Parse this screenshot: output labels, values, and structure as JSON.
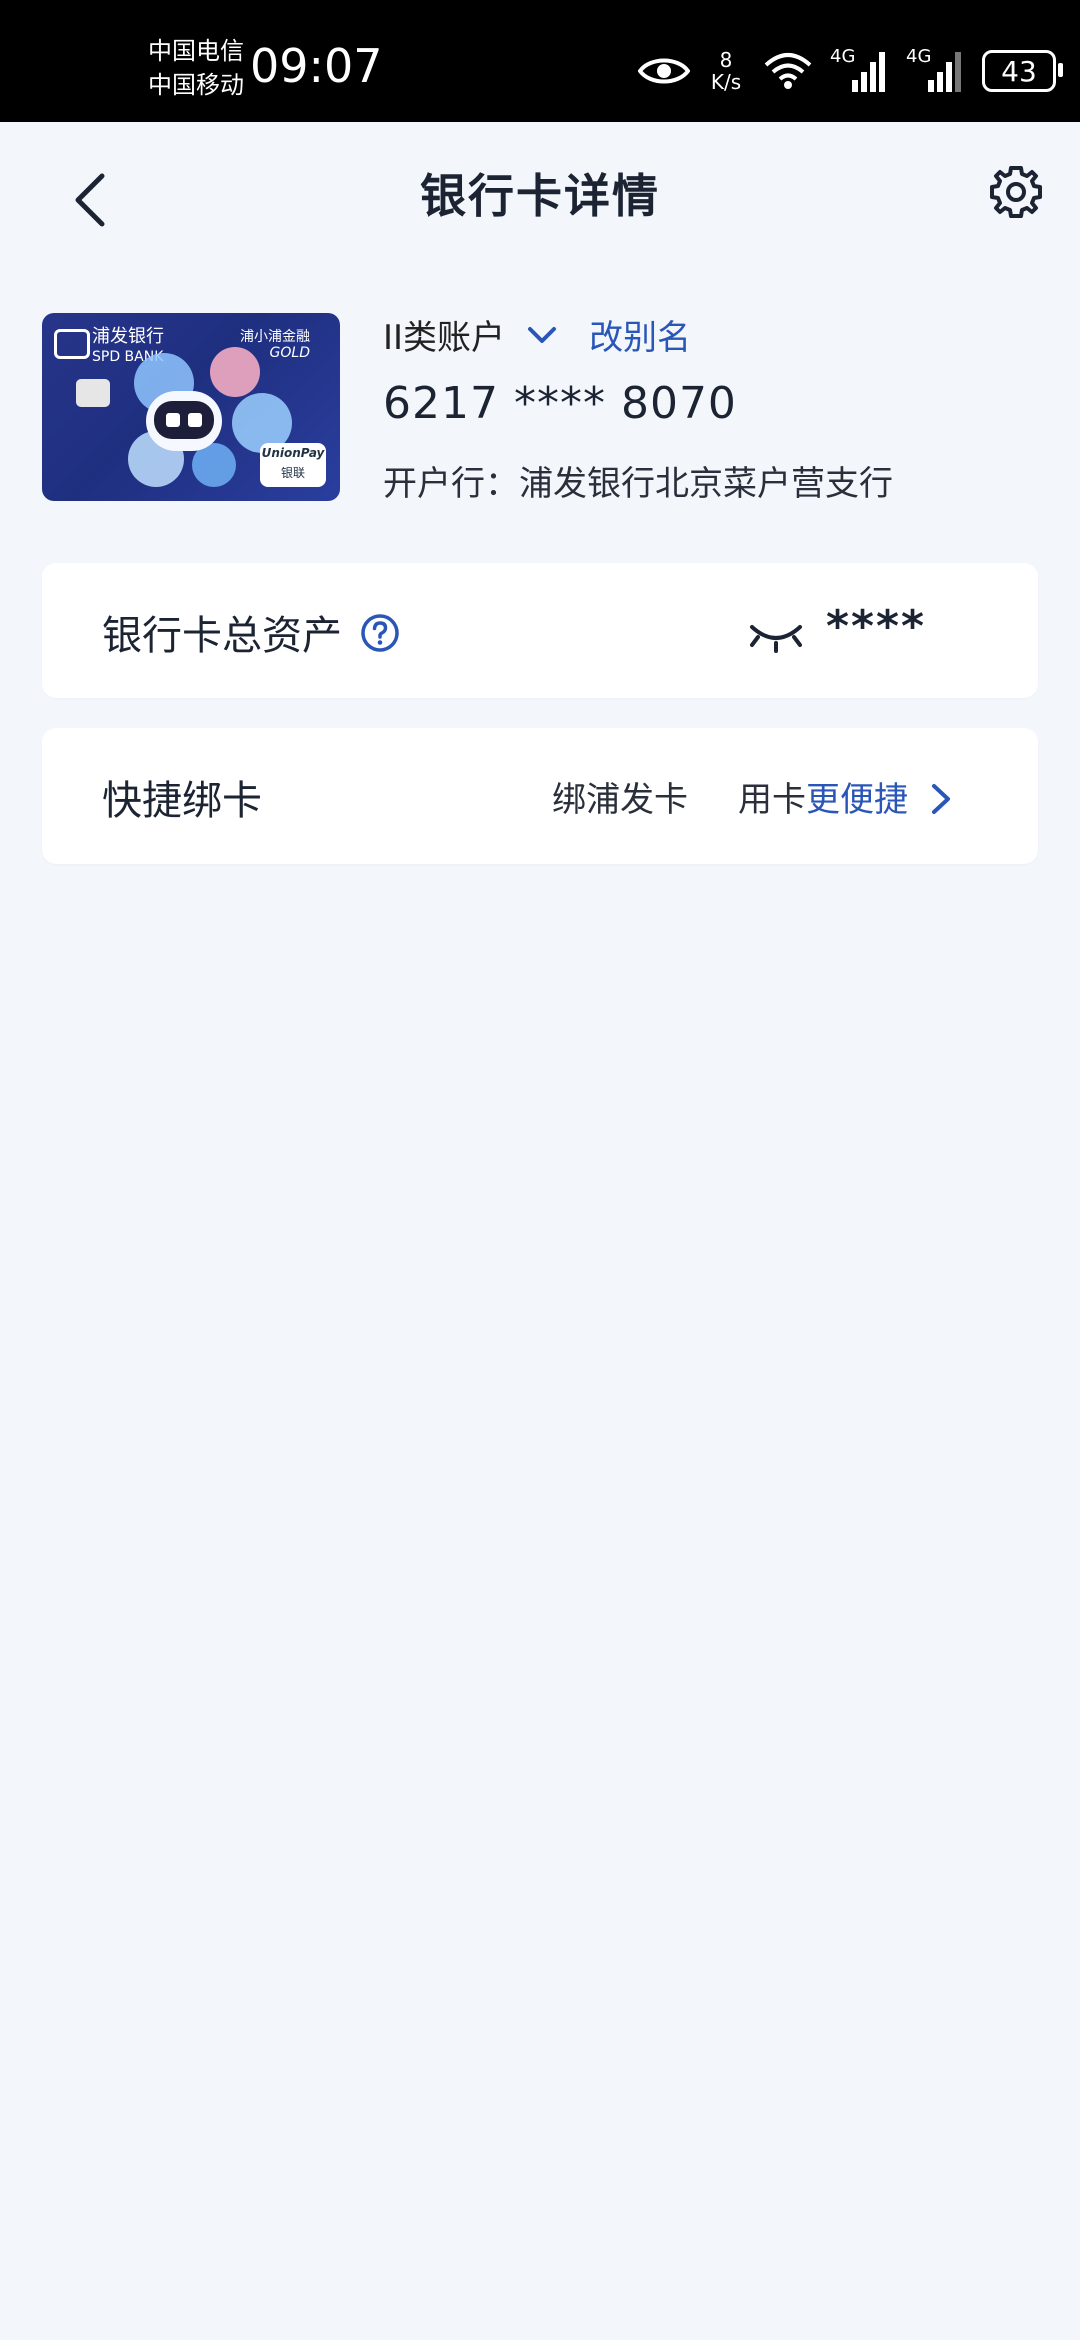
{
  "status_bar": {
    "carrier1": "中国电信",
    "carrier2": "中国移动",
    "time": "09:07",
    "speed_value": "8",
    "speed_unit": "K/s",
    "network1": "4G",
    "network2": "4G",
    "battery": "43"
  },
  "header": {
    "title": "银行卡详情"
  },
  "card": {
    "bank_name": "浦发银行",
    "bank_name_en": "SPD BANK",
    "card_badge": "浦小浦金融",
    "card_tier": "GOLD",
    "unionpay_label": "UnionPay",
    "unionpay_cn": "银联",
    "account_type": "II类账户",
    "rename_label": "改别名",
    "number": "6217 **** 8070",
    "branch": "开户行：浦发银行北京菜户营支行"
  },
  "assets": {
    "label": "银行卡总资产",
    "masked_value": "****"
  },
  "quick_bind": {
    "label": "快捷绑卡",
    "text1": "绑浦发卡",
    "text2_plain": "用卡",
    "text2_highlight": "更便捷"
  },
  "colors": {
    "accent": "#2a56b8",
    "background": "#f3f7fc"
  }
}
